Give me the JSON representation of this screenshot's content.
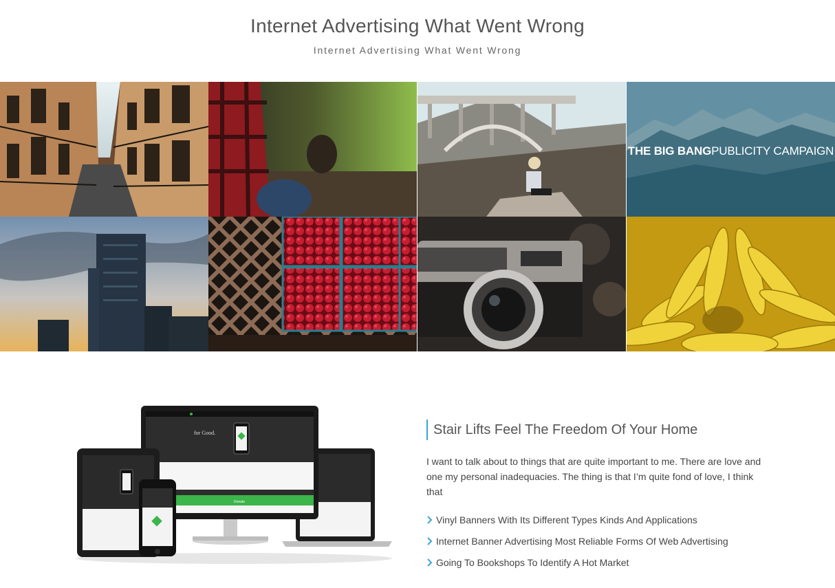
{
  "header": {
    "title": "Internet Advertising What Went Wrong",
    "subtitle": "Internet Advertising What Went Wrong"
  },
  "gallery": {
    "tiles": [
      {
        "name": "street-buildings-photo"
      },
      {
        "name": "person-plaid-shirt-photo"
      },
      {
        "name": "bridge-hiker-photo"
      },
      {
        "name": "mountains-photo",
        "caption_bold": "THE BIG BANG",
        "caption_rest": "PUBLICITY CAMPAIGN"
      },
      {
        "name": "skyscraper-sunset-photo"
      },
      {
        "name": "raspberries-photo"
      },
      {
        "name": "camera-photo"
      },
      {
        "name": "yellow-flower-photo"
      }
    ]
  },
  "feature": {
    "title": "Stair Lifts Feel The Freedom Of Your Home",
    "text": "I want to talk about to things that are quite important to me. There are love and one my personal inadequacies. The thing is that I’m quite fond of love, I think that",
    "list": [
      "Vinyl Banners With Its Different Types Kinds And Applications",
      "Internet Banner Advertising Most Reliable Forms Of Web Advertising",
      "Going To Bookshops To Identify A Hot Market"
    ],
    "bullet_icon": "chevron-right-icon",
    "accent_color": "#3aa6d8"
  },
  "devices_image": {
    "screen_title": "for Good.",
    "screen_button": "Donate"
  }
}
